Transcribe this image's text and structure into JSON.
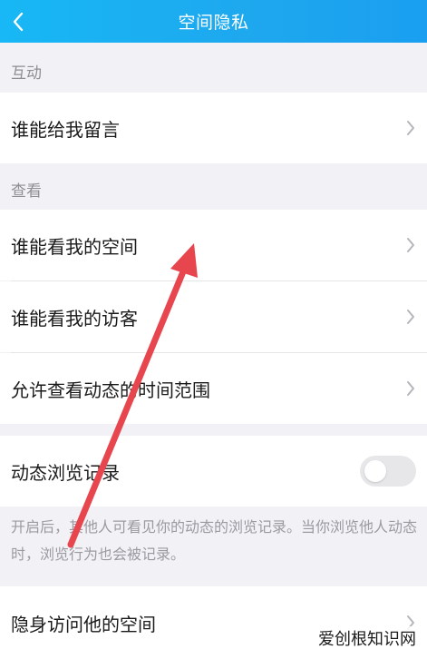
{
  "header": {
    "title": "空间隐私",
    "back_icon": "chevron-left-icon"
  },
  "sections": {
    "interact": {
      "label": "互动"
    },
    "view": {
      "label": "查看"
    }
  },
  "rows": {
    "leave_message": "谁能给我留言",
    "view_space": "谁能看我的空间",
    "view_visitors": "谁能看我的访客",
    "time_range": "允许查看动态的时间范围",
    "browse_record": "动态浏览记录",
    "stealth_visit": "隐身访问他的空间"
  },
  "browse_record_toggle": {
    "on": false
  },
  "description": "开启后，其他人可看见你的动态的浏览记录。当你浏览他人动态时，浏览行为也会被记录。",
  "watermark": "爱创根知识网",
  "colors": {
    "header": "#1ea7ee",
    "arrow": "#e8464e",
    "background": "#f2f2f6"
  }
}
